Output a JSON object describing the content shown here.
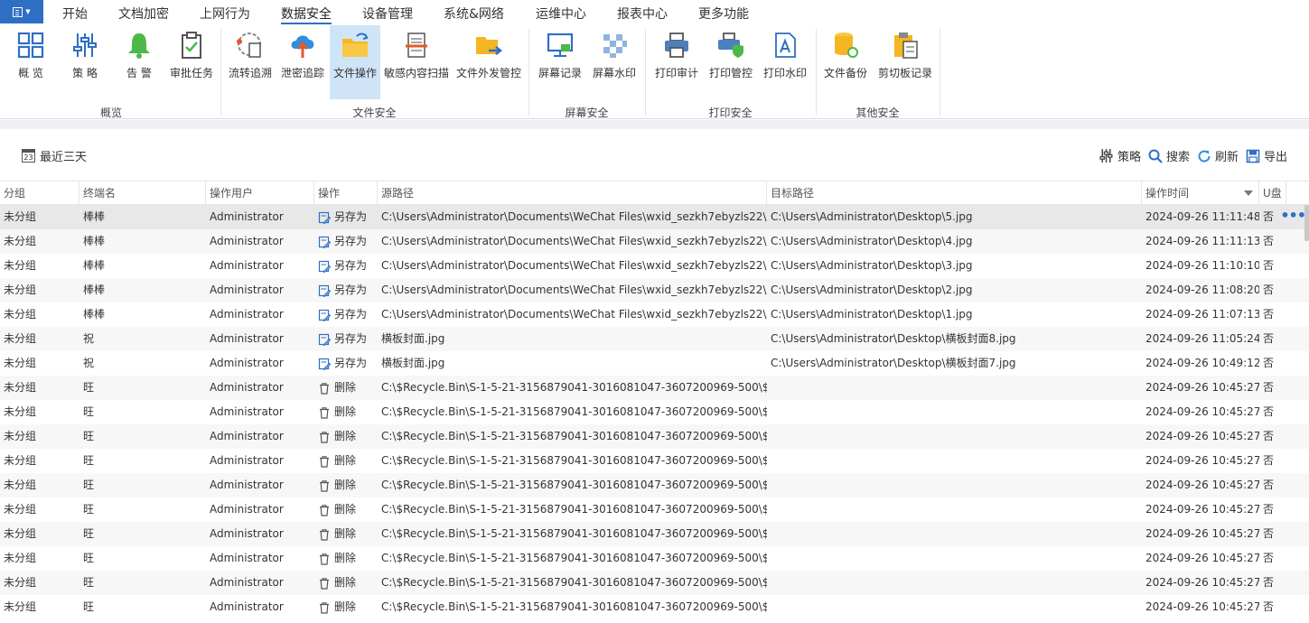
{
  "menu": {
    "tabs": [
      "开始",
      "文档加密",
      "上网行为",
      "数据安全",
      "设备管理",
      "系统&网络",
      "运维中心",
      "报表中心",
      "更多功能"
    ],
    "active_tab": "数据安全"
  },
  "ribbon": {
    "groups": {
      "overview": "概览",
      "file_security": "文件安全",
      "screen_security": "屏幕安全",
      "print_security": "打印安全",
      "other_security": "其他安全"
    },
    "buttons": {
      "overview": "概 览",
      "policy": "策 略",
      "alert": "告 警",
      "approval": "审批任务",
      "flow_trace": "流转追溯",
      "leak_trace": "泄密追踪",
      "file_ops": "文件操作",
      "sensitive_scan": "敏感内容扫描",
      "file_outgoing": "文件外发管控",
      "screen_record": "屏幕记录",
      "screen_watermark": "屏幕水印",
      "print_audit": "打印审计",
      "print_control": "打印管控",
      "print_watermark": "打印水印",
      "file_backup": "文件备份",
      "clipboard_record": "剪切板记录"
    }
  },
  "toolbar": {
    "date_filter": "最近三天",
    "calendar_day": "23",
    "policy": "策略",
    "search": "搜索",
    "refresh": "刷新",
    "export": "导出"
  },
  "table": {
    "columns": [
      "分组",
      "终端名",
      "操作用户",
      "操作",
      "源路径",
      "目标路径",
      "操作时间",
      "U盘"
    ],
    "rows": [
      [
        "未分组",
        "棒棒",
        "Administrator",
        "另存为",
        "C:\\Users\\Administrator\\Documents\\WeChat Files\\wxid_sezkh7ebyzls22\\...",
        "C:\\Users\\Administrator\\Desktop\\5.jpg",
        "2024-09-26 11:11:48",
        "否"
      ],
      [
        "未分组",
        "棒棒",
        "Administrator",
        "另存为",
        "C:\\Users\\Administrator\\Documents\\WeChat Files\\wxid_sezkh7ebyzls22\\...",
        "C:\\Users\\Administrator\\Desktop\\4.jpg",
        "2024-09-26 11:11:13",
        "否"
      ],
      [
        "未分组",
        "棒棒",
        "Administrator",
        "另存为",
        "C:\\Users\\Administrator\\Documents\\WeChat Files\\wxid_sezkh7ebyzls22\\...",
        "C:\\Users\\Administrator\\Desktop\\3.jpg",
        "2024-09-26 11:10:10",
        "否"
      ],
      [
        "未分组",
        "棒棒",
        "Administrator",
        "另存为",
        "C:\\Users\\Administrator\\Documents\\WeChat Files\\wxid_sezkh7ebyzls22\\...",
        "C:\\Users\\Administrator\\Desktop\\2.jpg",
        "2024-09-26 11:08:20",
        "否"
      ],
      [
        "未分组",
        "棒棒",
        "Administrator",
        "另存为",
        "C:\\Users\\Administrator\\Documents\\WeChat Files\\wxid_sezkh7ebyzls22\\...",
        "C:\\Users\\Administrator\\Desktop\\1.jpg",
        "2024-09-26 11:07:13",
        "否"
      ],
      [
        "未分组",
        "祝",
        "Administrator",
        "另存为",
        "横板封面.jpg",
        "C:\\Users\\Administrator\\Desktop\\横板封面8.jpg",
        "2024-09-26 11:05:24",
        "否"
      ],
      [
        "未分组",
        "祝",
        "Administrator",
        "另存为",
        "横板封面.jpg",
        "C:\\Users\\Administrator\\Desktop\\横板封面7.jpg",
        "2024-09-26 10:49:12",
        "否"
      ],
      [
        "未分组",
        "旺",
        "Administrator",
        "删除",
        "C:\\$Recycle.Bin\\S-1-5-21-3156879041-3016081047-3607200969-500\\$...",
        "",
        "2024-09-26 10:45:27",
        "否"
      ],
      [
        "未分组",
        "旺",
        "Administrator",
        "删除",
        "C:\\$Recycle.Bin\\S-1-5-21-3156879041-3016081047-3607200969-500\\$...",
        "",
        "2024-09-26 10:45:27",
        "否"
      ],
      [
        "未分组",
        "旺",
        "Administrator",
        "删除",
        "C:\\$Recycle.Bin\\S-1-5-21-3156879041-3016081047-3607200969-500\\$...",
        "",
        "2024-09-26 10:45:27",
        "否"
      ],
      [
        "未分组",
        "旺",
        "Administrator",
        "删除",
        "C:\\$Recycle.Bin\\S-1-5-21-3156879041-3016081047-3607200969-500\\$...",
        "",
        "2024-09-26 10:45:27",
        "否"
      ],
      [
        "未分组",
        "旺",
        "Administrator",
        "删除",
        "C:\\$Recycle.Bin\\S-1-5-21-3156879041-3016081047-3607200969-500\\$...",
        "",
        "2024-09-26 10:45:27",
        "否"
      ],
      [
        "未分组",
        "旺",
        "Administrator",
        "删除",
        "C:\\$Recycle.Bin\\S-1-5-21-3156879041-3016081047-3607200969-500\\$...",
        "",
        "2024-09-26 10:45:27",
        "否"
      ],
      [
        "未分组",
        "旺",
        "Administrator",
        "删除",
        "C:\\$Recycle.Bin\\S-1-5-21-3156879041-3016081047-3607200969-500\\$...",
        "",
        "2024-09-26 10:45:27",
        "否"
      ],
      [
        "未分组",
        "旺",
        "Administrator",
        "删除",
        "C:\\$Recycle.Bin\\S-1-5-21-3156879041-3016081047-3607200969-500\\$...",
        "",
        "2024-09-26 10:45:27",
        "否"
      ],
      [
        "未分组",
        "旺",
        "Administrator",
        "删除",
        "C:\\$Recycle.Bin\\S-1-5-21-3156879041-3016081047-3607200969-500\\$...",
        "",
        "2024-09-26 10:45:27",
        "否"
      ],
      [
        "未分组",
        "旺",
        "Administrator",
        "删除",
        "C:\\$Recycle.Bin\\S-1-5-21-3156879041-3016081047-3607200969-500\\$...",
        "",
        "2024-09-26 10:45:27",
        "否"
      ]
    ],
    "row_more": "•••"
  },
  "colors": {
    "accent": "#2e6fc4",
    "selected_row": "#e8e8e8",
    "ribbon_active": "#cfe5f7"
  }
}
